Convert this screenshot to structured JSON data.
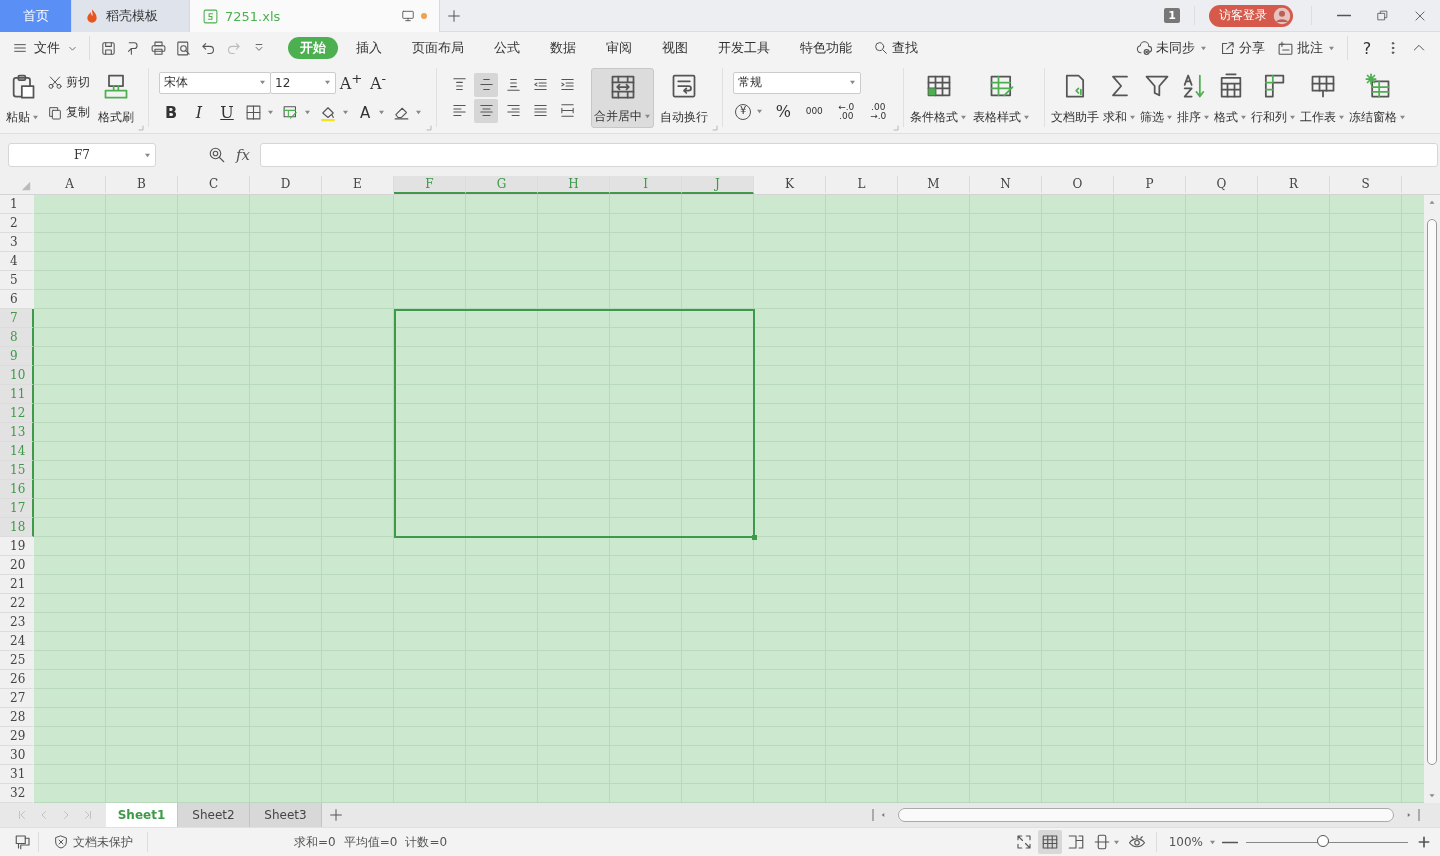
{
  "tabs": [
    {
      "label": "首页",
      "kind": "home",
      "selected": false,
      "modified": false
    },
    {
      "label": "稻壳模板",
      "kind": "docer",
      "selected": false,
      "modified": false
    },
    {
      "label": "7251.xls",
      "kind": "sheet",
      "selected": true,
      "modified": true
    }
  ],
  "account": {
    "badge": "1",
    "login": "访客登录"
  },
  "menu": {
    "file": "文件",
    "quick_access": [
      {
        "kind": "save",
        "disabled": false
      },
      {
        "kind": "brush",
        "disabled": false
      },
      {
        "kind": "print",
        "disabled": false
      },
      {
        "kind": "preview",
        "disabled": false
      },
      {
        "kind": "undo",
        "disabled": false
      },
      {
        "kind": "redo",
        "disabled": true
      },
      {
        "kind": "more",
        "disabled": false
      }
    ],
    "tabs": [
      {
        "label": "开始",
        "selected": true
      },
      {
        "label": "插入",
        "selected": false
      },
      {
        "label": "页面布局",
        "selected": false
      },
      {
        "label": "公式",
        "selected": false
      },
      {
        "label": "数据",
        "selected": false
      },
      {
        "label": "审阅",
        "selected": false
      },
      {
        "label": "视图",
        "selected": false
      },
      {
        "label": "开发工具",
        "selected": false
      },
      {
        "label": "特色功能",
        "selected": false
      }
    ],
    "search": "查找",
    "actions": [
      {
        "label": "未同步",
        "kind": "sync",
        "dropdown": true
      },
      {
        "label": "分享",
        "kind": "share",
        "dropdown": false
      },
      {
        "label": "批注",
        "kind": "comment",
        "dropdown": true
      }
    ],
    "help": "?"
  },
  "ribbon": {
    "clipboard": {
      "paste": "粘贴",
      "cut": "剪切",
      "copy": "复制",
      "painter": "格式刷"
    },
    "font": {
      "name": "宋体",
      "size": "12",
      "grow": "A$^{+}$",
      "shrink": "A$^{-}$",
      "styles": [
        {
          "label": "B",
          "kind": "bold"
        },
        {
          "label": "I",
          "kind": "italic"
        },
        {
          "label": "U",
          "kind": "underline"
        }
      ],
      "font_color": "A"
    },
    "alignment": {
      "rows": [
        [
          {
            "kind": "top",
            "selected": false
          },
          {
            "kind": "middle",
            "selected": true
          },
          {
            "kind": "bottom",
            "selected": false
          },
          {
            "kind": "outdent",
            "selected": false
          },
          {
            "kind": "indent",
            "selected": false
          }
        ],
        [
          {
            "kind": "left",
            "selected": false
          },
          {
            "kind": "center",
            "selected": true
          },
          {
            "kind": "right",
            "selected": false
          },
          {
            "kind": "justify",
            "selected": false
          },
          {
            "kind": "distributed",
            "selected": false
          }
        ]
      ],
      "merge": {
        "label": "合并居中",
        "selected": true
      },
      "wrap": "自动换行"
    },
    "number": {
      "format": "常规",
      "currency": "¥",
      "percent": "%",
      "thousands": "000",
      "increase": [
        "←.0",
        ".00"
      ],
      "decrease": [
        ".00",
        "→.0"
      ]
    },
    "styles": [
      {
        "label": "条件格式",
        "kind": "conditional",
        "dropdown": true
      },
      {
        "label": "表格样式",
        "kind": "tablestyle",
        "dropdown": true
      }
    ],
    "tools": [
      {
        "label": "文档助手",
        "kind": "assistant",
        "dropdown": false
      },
      {
        "label": "求和",
        "kind": "sum",
        "dropdown": true
      },
      {
        "label": "筛选",
        "kind": "filter",
        "dropdown": true
      },
      {
        "label": "排序",
        "kind": "sort",
        "dropdown": true
      },
      {
        "label": "格式",
        "kind": "format",
        "dropdown": true
      },
      {
        "label": "行和列",
        "kind": "rowcol",
        "dropdown": true
      },
      {
        "label": "工作表",
        "kind": "worksheet",
        "dropdown": true
      },
      {
        "label": "冻结窗格",
        "kind": "freeze",
        "dropdown": true
      }
    ]
  },
  "formula_bar": {
    "name_box": "F7",
    "fx": "fx"
  },
  "columns": [
    {
      "label": "A",
      "selected": false
    },
    {
      "label": "B",
      "selected": false
    },
    {
      "label": "C",
      "selected": false
    },
    {
      "label": "D",
      "selected": false
    },
    {
      "label": "E",
      "selected": false
    },
    {
      "label": "F",
      "selected": true
    },
    {
      "label": "G",
      "selected": true
    },
    {
      "label": "H",
      "selected": true
    },
    {
      "label": "I",
      "selected": true
    },
    {
      "label": "J",
      "selected": true
    },
    {
      "label": "K",
      "selected": false
    },
    {
      "label": "L",
      "selected": false
    },
    {
      "label": "M",
      "selected": false
    },
    {
      "label": "N",
      "selected": false
    },
    {
      "label": "O",
      "selected": false
    },
    {
      "label": "P",
      "selected": false
    },
    {
      "label": "Q",
      "selected": false
    },
    {
      "label": "R",
      "selected": false
    },
    {
      "label": "S",
      "selected": false
    }
  ],
  "rows": [
    {
      "label": "1",
      "selected": false
    },
    {
      "label": "2",
      "selected": false
    },
    {
      "label": "3",
      "selected": false
    },
    {
      "label": "4",
      "selected": false
    },
    {
      "label": "5",
      "selected": false
    },
    {
      "label": "6",
      "selected": false
    },
    {
      "label": "7",
      "selected": true
    },
    {
      "label": "8",
      "selected": true
    },
    {
      "label": "9",
      "selected": true
    },
    {
      "label": "10",
      "selected": true
    },
    {
      "label": "11",
      "selected": true
    },
    {
      "label": "12",
      "selected": true
    },
    {
      "label": "13",
      "selected": true
    },
    {
      "label": "14",
      "selected": true
    },
    {
      "label": "15",
      "selected": true
    },
    {
      "label": "16",
      "selected": true
    },
    {
      "label": "17",
      "selected": true
    },
    {
      "label": "18",
      "selected": true
    },
    {
      "label": "19",
      "selected": false
    },
    {
      "label": "20",
      "selected": false
    },
    {
      "label": "21",
      "selected": false
    },
    {
      "label": "22",
      "selected": false
    },
    {
      "label": "23",
      "selected": false
    },
    {
      "label": "24",
      "selected": false
    },
    {
      "label": "25",
      "selected": false
    },
    {
      "label": "26",
      "selected": false
    },
    {
      "label": "27",
      "selected": false
    },
    {
      "label": "28",
      "selected": false
    },
    {
      "label": "29",
      "selected": false
    },
    {
      "label": "30",
      "selected": false
    },
    {
      "label": "31",
      "selected": false
    },
    {
      "label": "32",
      "selected": false
    }
  ],
  "sheets": [
    {
      "label": "Sheet1",
      "selected": true
    },
    {
      "label": "Sheet2",
      "selected": false
    },
    {
      "label": "Sheet3",
      "selected": false
    }
  ],
  "status_bar": {
    "protection": "文档未保护",
    "stats": [
      "求和=0",
      "平均值=0",
      "计数=0"
    ],
    "views": [
      {
        "kind": "fullscreen",
        "selected": false,
        "dropdown": false
      },
      {
        "kind": "normal",
        "selected": true,
        "dropdown": false
      },
      {
        "kind": "pagebreak",
        "selected": false,
        "dropdown": false
      },
      {
        "kind": "reading",
        "selected": false,
        "dropdown": true
      },
      {
        "kind": "eyecare",
        "selected": false,
        "dropdown": false
      }
    ],
    "zoom": "100%",
    "zoom_slider": {
      "level": 0.47
    }
  }
}
